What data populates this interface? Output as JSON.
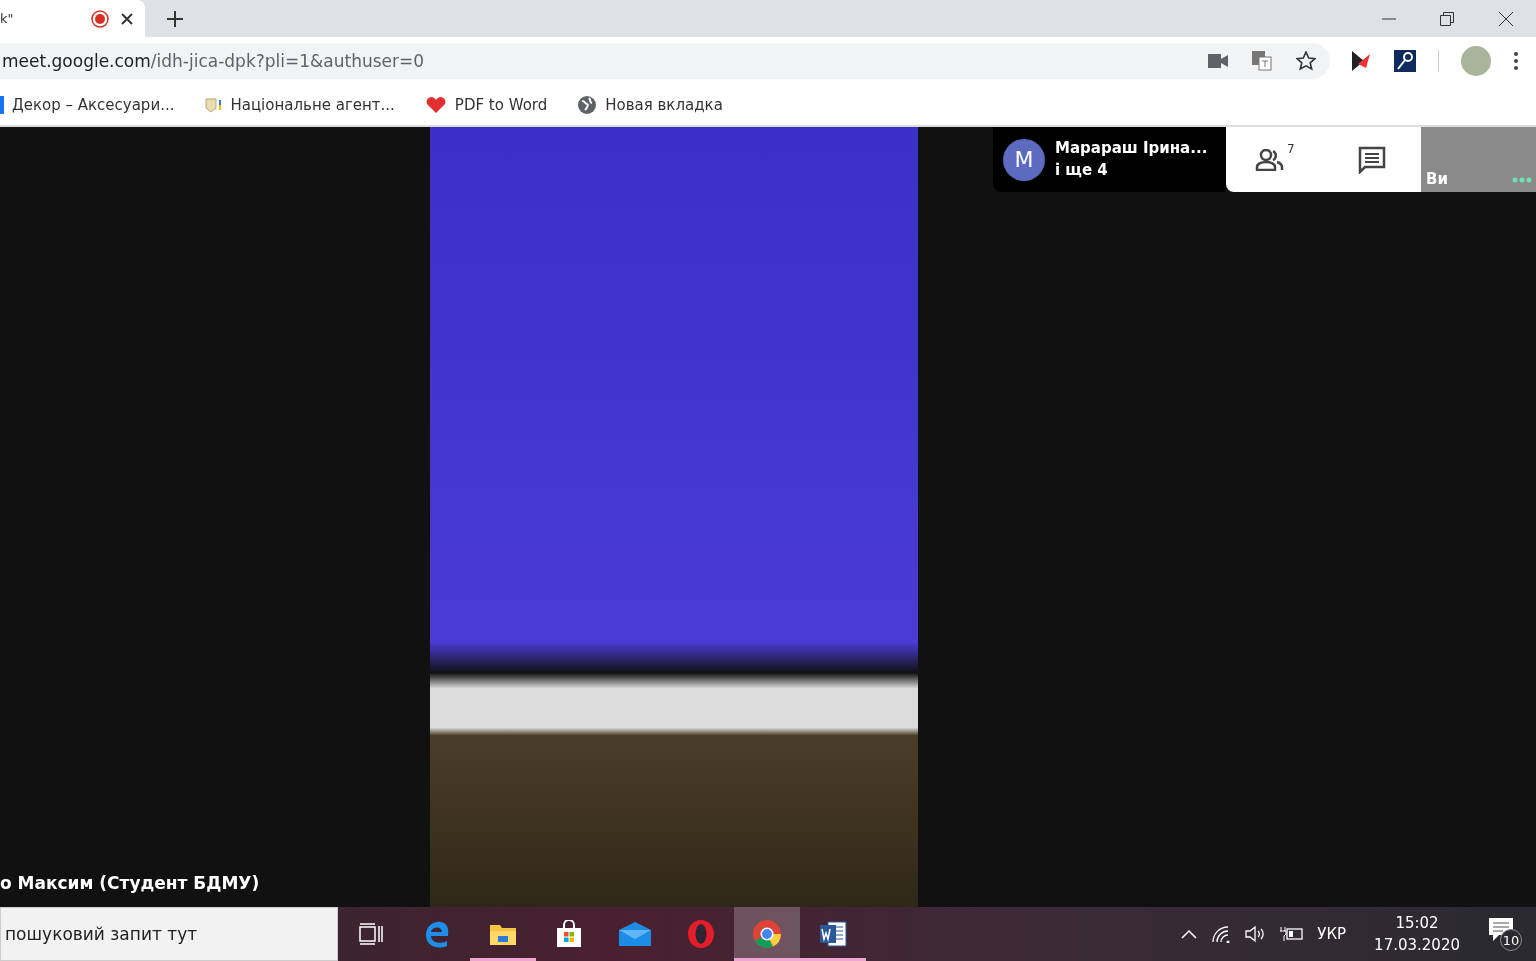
{
  "browser": {
    "tab": {
      "title": "k\"",
      "recording": true
    },
    "address": {
      "host": "meet.google.com",
      "path": "/idh-jica-dpk?pli=1&authuser=0"
    },
    "bookmarks": [
      {
        "label": "Декор – Аксесуари...",
        "kind": "page"
      },
      {
        "label": "Національне агент...",
        "kind": "emblem"
      },
      {
        "label": "PDF to Word",
        "kind": "heart"
      },
      {
        "label": "Новая вкладка",
        "kind": "globe"
      }
    ]
  },
  "meet": {
    "participants": {
      "avatar_letter": "M",
      "name": "Марараш Ірина...",
      "more": "і ще 4"
    },
    "people_count": "7",
    "self_label": "Ви",
    "presenter": "о Максим (Студент БДМУ)"
  },
  "taskbar": {
    "search_placeholder": "пошуковий запит тут",
    "apps": [
      {
        "kind": "taskview",
        "running": false,
        "selected": false
      },
      {
        "kind": "edge",
        "running": false,
        "selected": false
      },
      {
        "kind": "explorer",
        "running": true,
        "selected": false
      },
      {
        "kind": "store",
        "running": false,
        "selected": false
      },
      {
        "kind": "mail",
        "running": false,
        "selected": false
      },
      {
        "kind": "opera",
        "running": false,
        "selected": false
      },
      {
        "kind": "chrome",
        "running": true,
        "selected": true
      },
      {
        "kind": "word",
        "running": true,
        "selected": false
      }
    ],
    "language": "УКР",
    "time": "15:02",
    "date": "17.03.2020",
    "notifications": "10"
  }
}
